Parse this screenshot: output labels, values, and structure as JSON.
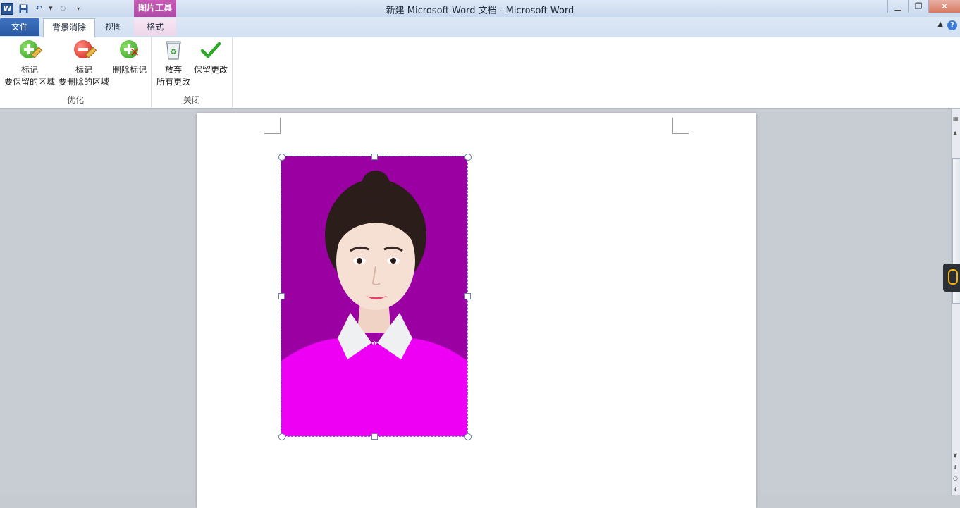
{
  "window": {
    "title": "新建 Microsoft Word 文档 - Microsoft Word",
    "context_tab_group": "图片工具",
    "app_icon_letter": "W"
  },
  "tabs": {
    "file": "文件",
    "background_removal": "背景消除",
    "view": "视图",
    "format": "格式"
  },
  "ribbon": {
    "refine_group": {
      "label": "优化",
      "mark_keep": [
        "标记",
        "要保留的区域"
      ],
      "mark_remove": [
        "标记",
        "要删除的区域"
      ],
      "delete_mark": "删除标记"
    },
    "close_group": {
      "label": "关闭",
      "discard": [
        "放弃",
        "所有更改"
      ],
      "keep": "保留更改"
    }
  },
  "colors": {
    "photo_background": "#9a00a2",
    "sweater": "#ee00f5",
    "accent_blue": "#2b5797"
  },
  "icons": {
    "save": "save-icon",
    "undo": "undo-icon",
    "redo": "redo-icon",
    "customize": "dropdown-icon"
  }
}
